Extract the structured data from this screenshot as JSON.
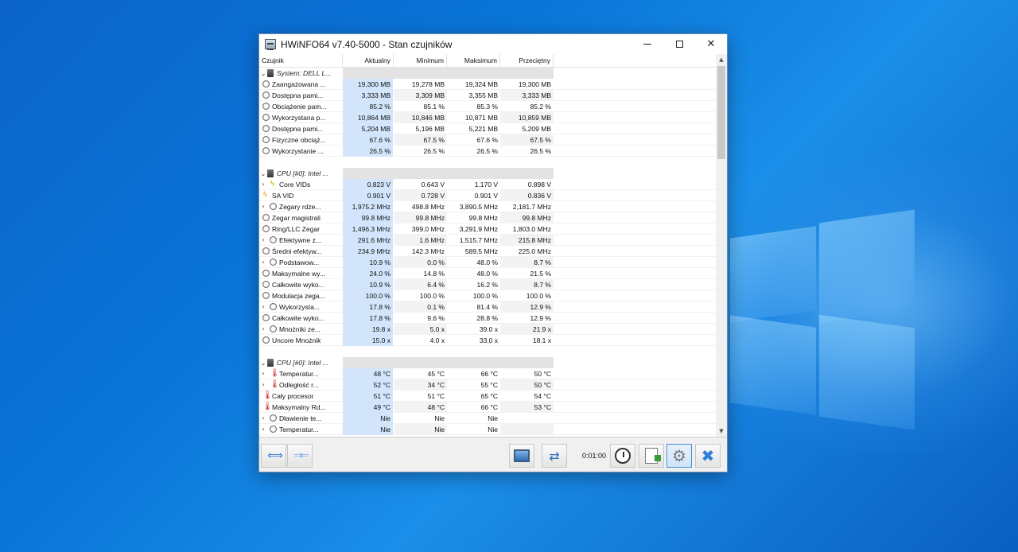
{
  "window": {
    "title": "HWiNFO64 v7.40-5000 - Stan czujników",
    "minimize_label": "",
    "maximize_label": "",
    "close_label": "✕"
  },
  "columns": {
    "name": "Czujnik",
    "current": "Aktualny",
    "minimum": "Minimum",
    "maximum": "Maksimum",
    "average": "Przeciętny"
  },
  "groups": [
    {
      "title": "System: DELL L...",
      "rows": [
        {
          "label": "Zaangażowana ...",
          "icon": "gauge-icon",
          "expand": false,
          "cur": "19,300 MB",
          "min": "19,278 MB",
          "max": "19,324 MB",
          "avg": "19,300 MB"
        },
        {
          "label": "Dostępna pami...",
          "icon": "gauge-icon",
          "expand": false,
          "cur": "3,333 MB",
          "min": "3,309 MB",
          "max": "3,355 MB",
          "avg": "3,333 MB"
        },
        {
          "label": "Obciążenie pam...",
          "icon": "gauge-icon",
          "expand": false,
          "cur": "85.2 %",
          "min": "85.1 %",
          "max": "85.3 %",
          "avg": "85.2 %"
        },
        {
          "label": "Wykorzystana p...",
          "icon": "gauge-icon",
          "expand": false,
          "cur": "10,864 MB",
          "min": "10,846 MB",
          "max": "10,871 MB",
          "avg": "10,859 MB"
        },
        {
          "label": "Dostępna pami...",
          "icon": "gauge-icon",
          "expand": false,
          "cur": "5,204 MB",
          "min": "5,196 MB",
          "max": "5,221 MB",
          "avg": "5,209 MB"
        },
        {
          "label": "Fizyczne obciąż...",
          "icon": "gauge-icon",
          "expand": false,
          "cur": "67.6 %",
          "min": "67.5 %",
          "max": "67.6 %",
          "avg": "67.5 %"
        },
        {
          "label": "Wykorzystanie ...",
          "icon": "gauge-icon",
          "expand": false,
          "cur": "26.5 %",
          "min": "26.5 %",
          "max": "26.5 %",
          "avg": "26.5 %"
        }
      ]
    },
    {
      "title": "CPU [#0]: Intel ...",
      "rows": [
        {
          "label": "Core VIDs",
          "icon": "bolt-icon",
          "expand": true,
          "cur": "0.823 V",
          "min": "0.643 V",
          "max": "1.170 V",
          "avg": "0.898 V"
        },
        {
          "label": "SA VID",
          "icon": "bolt-icon",
          "expand": false,
          "cur": "0.901 V",
          "min": "0.728 V",
          "max": "0.901 V",
          "avg": "0.836 V"
        },
        {
          "label": "Zegary rdze...",
          "icon": "gauge-icon",
          "expand": true,
          "cur": "1,975.2 MHz",
          "min": "498.8 MHz",
          "max": "3,890.5 MHz",
          "avg": "2,181.7 MHz"
        },
        {
          "label": "Zegar magistrali",
          "icon": "gauge-icon",
          "expand": false,
          "cur": "99.8 MHz",
          "min": "99.8 MHz",
          "max": "99.8 MHz",
          "avg": "99.8 MHz"
        },
        {
          "label": "Ring/LLC Zegar",
          "icon": "gauge-icon",
          "expand": false,
          "cur": "1,496.3 MHz",
          "min": "399.0 MHz",
          "max": "3,291.9 MHz",
          "avg": "1,803.0 MHz"
        },
        {
          "label": "Efektywne z...",
          "icon": "gauge-icon",
          "expand": true,
          "cur": "291.6 MHz",
          "min": "1.6 MHz",
          "max": "1,515.7 MHz",
          "avg": "215.8 MHz"
        },
        {
          "label": "Średni efektyw...",
          "icon": "gauge-icon",
          "expand": false,
          "cur": "234.9 MHz",
          "min": "142.3 MHz",
          "max": "589.5 MHz",
          "avg": "225.0 MHz"
        },
        {
          "label": "Podstawow...",
          "icon": "gauge-icon",
          "expand": true,
          "cur": "10.9 %",
          "min": "0.0 %",
          "max": "48.0 %",
          "avg": "8.7 %"
        },
        {
          "label": "Maksymalne wy...",
          "icon": "gauge-icon",
          "expand": false,
          "cur": "24.0 %",
          "min": "14.8 %",
          "max": "48.0 %",
          "avg": "21.5 %"
        },
        {
          "label": "Całkowite wyko...",
          "icon": "gauge-icon",
          "expand": false,
          "cur": "10.9 %",
          "min": "6.4 %",
          "max": "16.2 %",
          "avg": "8.7 %"
        },
        {
          "label": "Modulacja zega...",
          "icon": "gauge-icon",
          "expand": false,
          "cur": "100.0 %",
          "min": "100.0 %",
          "max": "100.0 %",
          "avg": "100.0 %"
        },
        {
          "label": "Wykorzysta...",
          "icon": "gauge-icon",
          "expand": true,
          "cur": "17.8 %",
          "min": "0.1 %",
          "max": "81.4 %",
          "avg": "12.9 %"
        },
        {
          "label": "Całkowite wyko...",
          "icon": "gauge-icon",
          "expand": false,
          "cur": "17.8 %",
          "min": "9.6 %",
          "max": "28.8 %",
          "avg": "12.9 %"
        },
        {
          "label": "Mnożniki ze...",
          "icon": "gauge-icon",
          "expand": true,
          "cur": "19.8 x",
          "min": "5.0 x",
          "max": "39.0 x",
          "avg": "21.9 x"
        },
        {
          "label": "Uncore Mnożnik",
          "icon": "gauge-icon",
          "expand": false,
          "cur": "15.0 x",
          "min": "4.0 x",
          "max": "33.0 x",
          "avg": "18.1 x"
        }
      ]
    },
    {
      "title": "CPU [#0]: Intel ...",
      "rows": [
        {
          "label": "Temperatur...",
          "icon": "thermometer-icon",
          "expand": true,
          "cur": "48 °C",
          "min": "45 °C",
          "max": "66 °C",
          "avg": "50 °C"
        },
        {
          "label": "Odległość r...",
          "icon": "thermometer-icon",
          "expand": true,
          "cur": "52 °C",
          "min": "34 °C",
          "max": "55 °C",
          "avg": "50 °C"
        },
        {
          "label": "Cały procesor",
          "icon": "thermometer-icon",
          "expand": false,
          "cur": "51 °C",
          "min": "51 °C",
          "max": "65 °C",
          "avg": "54 °C"
        },
        {
          "label": "Maksymalny Rd...",
          "icon": "thermometer-icon",
          "expand": false,
          "cur": "49 °C",
          "min": "48 °C",
          "max": "66 °C",
          "avg": "53 °C"
        },
        {
          "label": "Dławienie te...",
          "icon": "gauge-icon",
          "expand": true,
          "cur": "Nie",
          "min": "Nie",
          "max": "Nie",
          "avg": ""
        },
        {
          "label": "Temperatur...",
          "icon": "gauge-icon",
          "expand": true,
          "cur": "Nie",
          "min": "Nie",
          "max": "Nie",
          "avg": ""
        }
      ]
    }
  ],
  "toolbar": {
    "timer": "0:01:00",
    "buttons": [
      "nav-arrows-icon",
      "nav-arrows-collapse-icon",
      "monitor-icon",
      "network-icon",
      "clock-icon",
      "report-icon",
      "settings-gear-icon",
      "close-x-icon"
    ]
  },
  "colors": {
    "current_column": "#d2e5fb",
    "accent": "#2d7fd8",
    "desktop": "#0a76d8"
  }
}
